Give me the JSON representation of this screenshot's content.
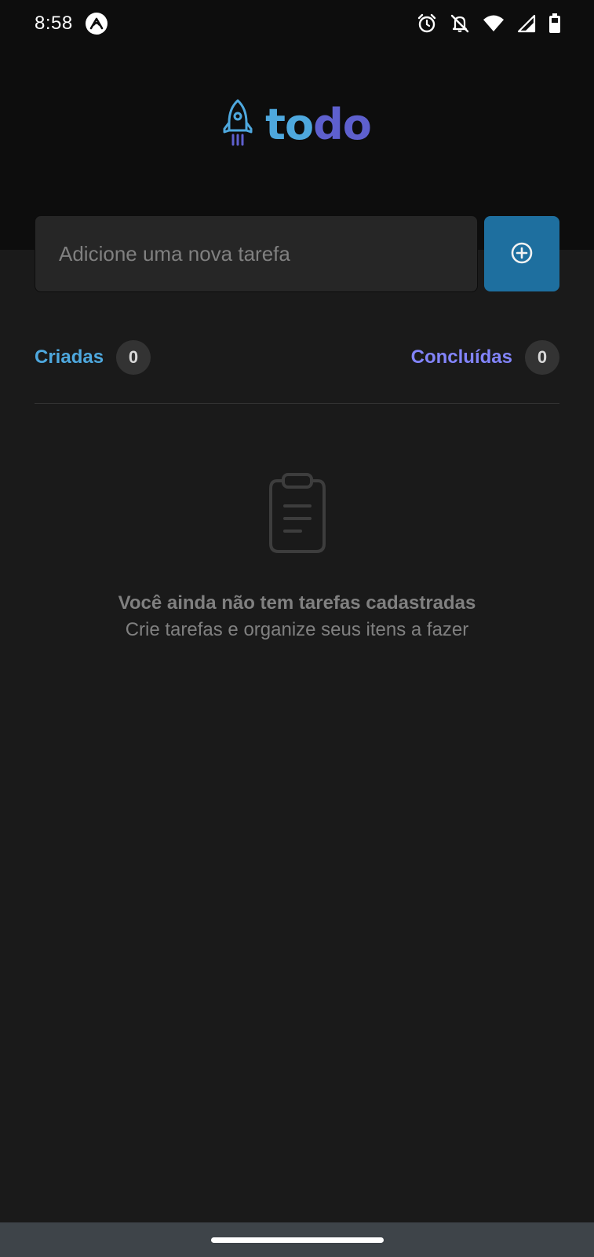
{
  "status_bar": {
    "time": "8:58",
    "icons": [
      "expo-icon",
      "alarm-icon",
      "notifications-off-icon",
      "wifi-icon",
      "signal-icon",
      "battery-icon"
    ]
  },
  "logo": {
    "icon": "rocket-icon",
    "text_part1": "to",
    "text_part2": "do",
    "color_part1": "#4ea8de",
    "color_part2": "#5e60ce"
  },
  "new_task": {
    "placeholder": "Adicione uma nova tarefa",
    "value": "",
    "button_icon": "plus-circle-icon"
  },
  "counters": {
    "created_label": "Criadas",
    "created_count": "0",
    "done_label": "Concluídas",
    "done_count": "0"
  },
  "empty_state": {
    "icon": "clipboard-icon",
    "title": "Você ainda não tem tarefas cadastradas",
    "subtitle": "Crie tarefas e organize seus itens a fazer"
  },
  "colors": {
    "background": "#1a1a1a",
    "header": "#0d0d0d",
    "input": "#262626",
    "button": "#1e6f9f",
    "blue": "#4ea8de",
    "purple": "#8284fa",
    "badge": "#333333"
  }
}
